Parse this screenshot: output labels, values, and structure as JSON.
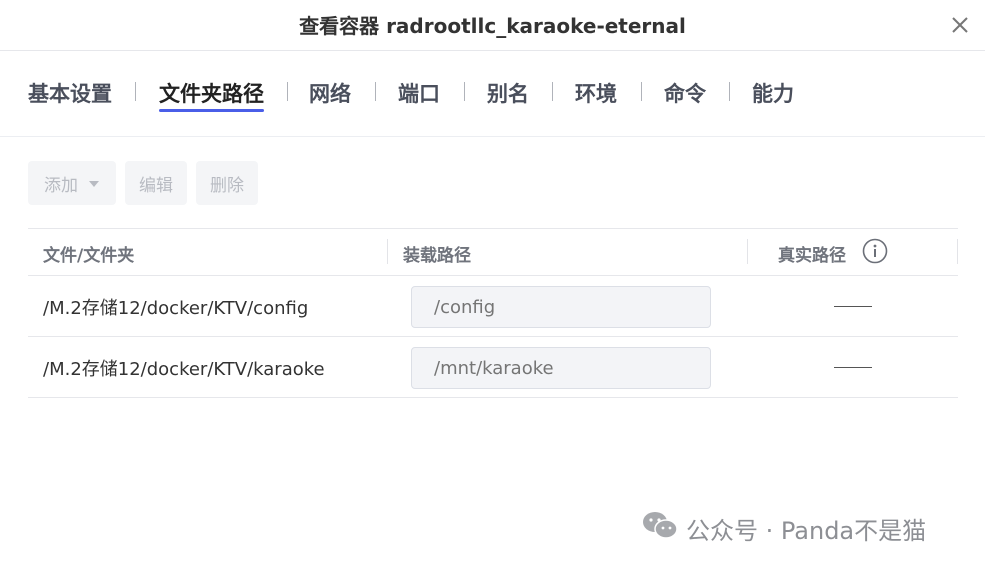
{
  "dialog": {
    "title": "查看容器 radrootllc_karaoke-eternal"
  },
  "tabs": [
    {
      "label": "基本设置"
    },
    {
      "label": "文件夹路径"
    },
    {
      "label": "网络"
    },
    {
      "label": "端口"
    },
    {
      "label": "别名"
    },
    {
      "label": "环境"
    },
    {
      "label": "命令"
    },
    {
      "label": "能力"
    }
  ],
  "active_tab": "文件夹路径",
  "toolbar": {
    "add_label": "添加",
    "edit_label": "编辑",
    "delete_label": "删除"
  },
  "table": {
    "headers": {
      "folder": "文件/文件夹",
      "mount": "装载路径",
      "real": "真实路径"
    },
    "rows": [
      {
        "folder": "/M.2存储12/docker/KTV/config",
        "mount_placeholder": "/config"
      },
      {
        "folder": "/M.2存储12/docker/KTV/karaoke",
        "mount_placeholder": "/mnt/karaoke"
      }
    ]
  },
  "watermark": {
    "text": "公众号 · Panda不是猫"
  },
  "colors": {
    "accent": "#4a5ee8",
    "disabled_text": "#b8bbc2"
  },
  "icons": [
    "close-icon",
    "chevron-down-icon",
    "info-icon",
    "wechat-icon"
  ]
}
